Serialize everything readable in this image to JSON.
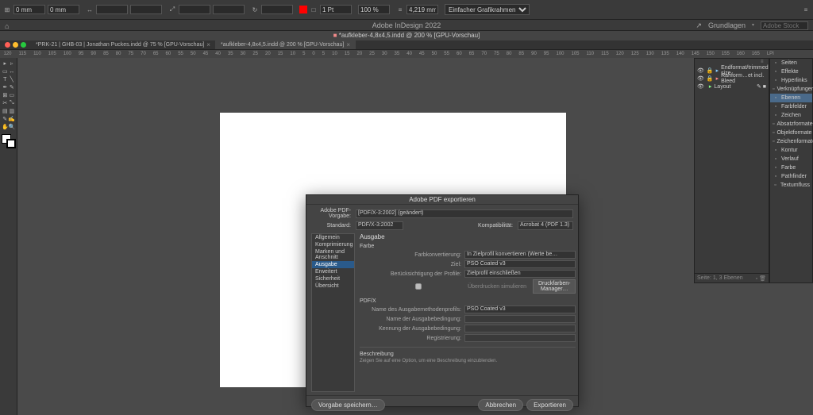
{
  "toolbar": {
    "x": "0 mm",
    "y": "0 mm",
    "w": "4,219 mm",
    "h": "",
    "stroke": "1 Pt",
    "zoom": "100 %",
    "frame_type": "Einfacher Grafikrahmen"
  },
  "app": {
    "title": "Adobe InDesign 2022",
    "workspace": "Grundlagen",
    "search_placeholder": "Adobe Stock"
  },
  "doc": {
    "title": "*aufkleber-4,8x4,5.indd @ 200 % [GPU-Vorschau]",
    "tabs": [
      {
        "label": "*PRK-21 | GHB-03 | Jonathan Puckes.indd @ 75 % [GPU-Vorschau]",
        "active": false
      },
      {
        "label": "*aufkleber-4,8x4,5.indd @ 200 % [GPU-Vorschau]",
        "active": true
      }
    ]
  },
  "ruler_ticks": [
    "120",
    "115",
    "110",
    "105",
    "100",
    "95",
    "90",
    "85",
    "80",
    "75",
    "70",
    "65",
    "60",
    "55",
    "50",
    "45",
    "40",
    "35",
    "30",
    "25",
    "20",
    "15",
    "10",
    "5",
    "0",
    "5",
    "10",
    "15",
    "20",
    "25",
    "30",
    "35",
    "40",
    "45",
    "50",
    "55",
    "60",
    "65",
    "70",
    "75",
    "80",
    "85",
    "90",
    "95",
    "100",
    "105",
    "110",
    "115",
    "120",
    "125",
    "130",
    "135",
    "140",
    "145",
    "150",
    "155",
    "160",
    "165",
    "LPI"
  ],
  "layers": {
    "items": [
      {
        "name": "Endformat/trimmed size",
        "locked": true
      },
      {
        "name": "Rahform…et incl. Bleed",
        "locked": true
      },
      {
        "name": "Layout",
        "locked": false,
        "selected": true
      }
    ],
    "footer": "Seite: 1, 3 Ebenen"
  },
  "side_panels": [
    "Seiten",
    "Effekte",
    "Hyperlinks",
    "Verknüpfungen",
    "Ebenen",
    "Farbfelder",
    "Zeichen",
    "Absatzformate",
    "Objektformate",
    "Zeichenformate",
    "Kontur",
    "Verlauf",
    "Farbe",
    "Pathfinder",
    "Textumfluss"
  ],
  "dialog": {
    "title": "Adobe PDF exportieren",
    "preset_label": "Adobe PDF-Vorgabe:",
    "preset_value": "[PDF/X-3:2002] (geändert)",
    "standard_label": "Standard:",
    "standard_value": "PDF/X-3:2002",
    "compat_label": "Kompatibilität:",
    "compat_value": "Acrobat 4 (PDF 1.3)",
    "sidebar": [
      "Allgemein",
      "Komprimierung",
      "Marken und Anschnitt",
      "Ausgabe",
      "Erweitert",
      "Sicherheit",
      "Übersicht"
    ],
    "active_tab": "Ausgabe",
    "heading": "Ausgabe",
    "section_farbe": "Farbe",
    "farbkonv_label": "Farbkonvertierung:",
    "farbkonv_value": "In Zielprofil konvertieren (Werte be…",
    "ziel_label": "Ziel:",
    "ziel_value": "PSO Coated v3",
    "profile_label": "Berücksichtigung der Profile:",
    "profile_value": "Zielprofil einschließen",
    "overprint_label": "Überdrucken simulieren",
    "farben_manager": "Druckfarben-Manager…",
    "section_pdfx": "PDF/X",
    "pdfx_profile_label": "Name des Ausgabemethodenprofils:",
    "pdfx_profile_value": "PSO Coated v3",
    "pdfx_bedingung_label": "Name der Ausgabebedingung:",
    "pdfx_kennung_label": "Kennung der Ausgabebedingung:",
    "pdfx_reg_label": "Registrierung:",
    "desc_heading": "Beschreibung",
    "desc_text": "Zeigen Sie auf eine Option, um eine Beschreibung einzublenden.",
    "save_preset": "Vorgabe speichern…",
    "cancel": "Abbrechen",
    "export": "Exportieren"
  }
}
